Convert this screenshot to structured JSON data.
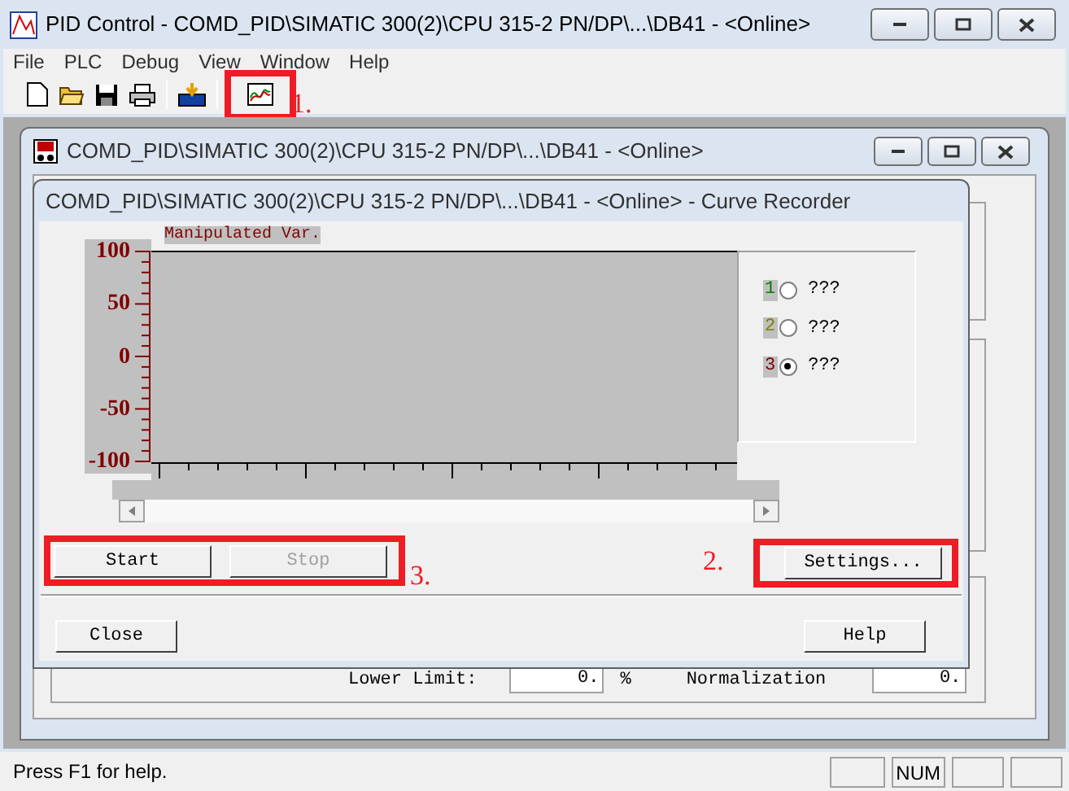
{
  "window": {
    "title": "PID Control - COMD_PID\\SIMATIC 300(2)\\CPU 315-2 PN/DP\\...\\DB41 - <Online>"
  },
  "menu": [
    "File",
    "PLC",
    "Debug",
    "View",
    "Window",
    "Help"
  ],
  "toolbar": [
    {
      "kind": "new"
    },
    {
      "kind": "open"
    },
    {
      "kind": "save"
    },
    {
      "kind": "print"
    },
    {
      "kind": "separator"
    },
    {
      "kind": "download"
    },
    {
      "kind": "separator"
    },
    {
      "kind": "curve"
    }
  ],
  "child_window": {
    "title": "COMD_PID\\SIMATIC 300(2)\\CPU 315-2 PN/DP\\...\\DB41 - <Online>",
    "limits_row": {
      "lower_limit_label": "Lower Limit:",
      "lower_limit_value": "0.",
      "unit": "%",
      "normalization_label": "Normalization",
      "normalization_value": "0."
    }
  },
  "dialog": {
    "title": "COMD_PID\\SIMATIC 300(2)\\CPU 315-2 PN/DP\\...\\DB41 - <Online> - Curve Recorder",
    "chart_title": "Manipulated Var.",
    "y_axis_labels": [
      "100",
      "50",
      "0",
      "-50",
      "-100"
    ],
    "curves": [
      {
        "number": "1",
        "label": "???",
        "color": "#008000",
        "selected": false
      },
      {
        "number": "2",
        "label": "???",
        "color": "#808000",
        "selected": false
      },
      {
        "number": "3",
        "label": "???",
        "color": "#800000",
        "selected": true
      }
    ],
    "buttons": [
      {
        "label": "Start",
        "disabled": false
      },
      {
        "label": "Stop",
        "disabled": true
      }
    ],
    "settings_button": "Settings...",
    "close_button": "Close",
    "help_button": "Help"
  },
  "annotations": [
    {
      "label": "1."
    },
    {
      "label": "2."
    },
    {
      "label": "3."
    }
  ],
  "status_bar": {
    "text": "Press F1 for help.",
    "num_indicator": "NUM"
  }
}
